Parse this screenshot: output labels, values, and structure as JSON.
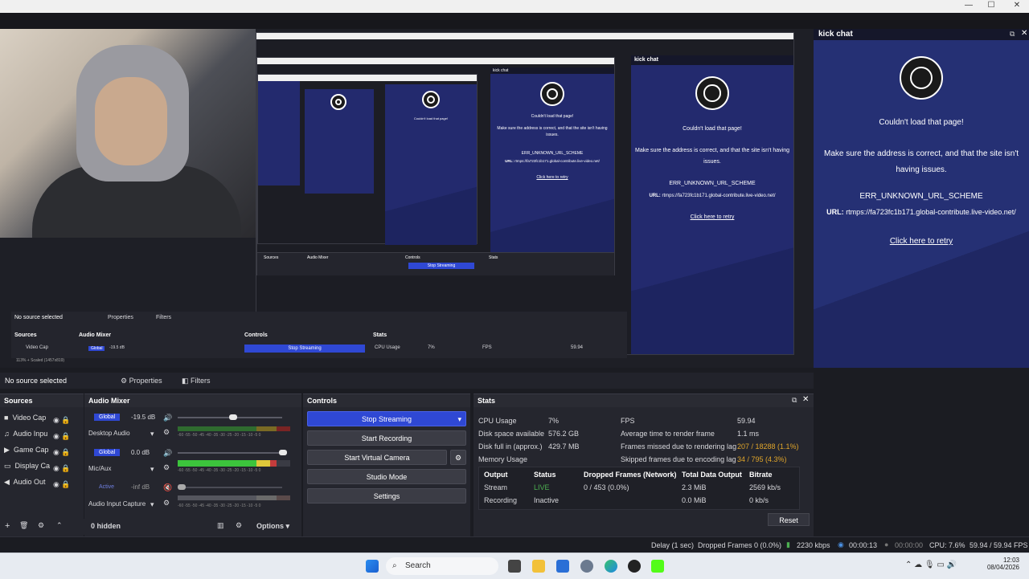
{
  "window": {
    "minimize": "—",
    "maximize": "☐",
    "close": "✕"
  },
  "preview": {
    "nested_chat_title": "kick chat",
    "nested_error_title": "Couldn't load that page!",
    "nested_error_body": "Make sure the address is correct, and that the site isn't having issues.",
    "nested_error_code": "ERR_UNKNOWN_URL_SCHEME",
    "nested_url_label": "URL:",
    "nested_url": "rtmps://fa723fc1b171.global-contribute.live-video.net/",
    "nested_retry": "Click here to retry",
    "nested_no_source": "No source selected",
    "nested_properties": "Properties",
    "nested_filters": "Filters",
    "nested_sources": "Sources",
    "nested_audio_mixer": "Audio Mixer",
    "nested_controls": "Controls",
    "nested_stats": "Stats",
    "nested_video_cap": "Video Cap",
    "nested_stop_streaming": "Stop Streaming",
    "nested_cpu_usage": "CPU Usage",
    "nested_cpu_value": "7%",
    "nested_fps": "FPS",
    "nested_fps_value": "59.94",
    "nested_global": "Global",
    "nested_db": "-19.5 dB",
    "nested_scaled": "113%   +   Scaled (1457x819)"
  },
  "kick_chat": {
    "title": "kick chat",
    "error_title": "Couldn't load that page!",
    "error_body": "Make sure the address is correct, and that the site isn't having issues.",
    "error_code": "ERR_UNKNOWN_URL_SCHEME",
    "url_label": "URL:",
    "url": "rtmps://fa723fc1b171.global-contribute.live-video.net/",
    "retry": "Click here to retry"
  },
  "status_row": {
    "no_source": "No source selected",
    "properties": "Properties",
    "filters": "Filters"
  },
  "sources": {
    "title": "Sources",
    "items": [
      "Video Cap",
      "Audio Inpu",
      "Game Cap",
      "Display Ca",
      "Audio Out"
    ]
  },
  "audio_mixer": {
    "title": "Audio Mixer",
    "channels": [
      {
        "badge": "Global",
        "db": "-19.5 dB",
        "name": "Desktop Audio",
        "level": 0.62
      },
      {
        "badge": "Global",
        "db": "0.0 dB",
        "name": "Mic/Aux",
        "level": 1.0
      },
      {
        "badge": "Active",
        "db": "-inf dB",
        "name": "Audio Input Capture",
        "level": 0.0
      }
    ],
    "ticks": "-60 -55 -50 -45 -40 -35 -30 -25 -20 -15 -10 -5 0"
  },
  "controls": {
    "title": "Controls",
    "stop_streaming": "Stop Streaming",
    "start_recording": "Start Recording",
    "start_virtual_camera": "Start Virtual Camera",
    "studio_mode": "Studio Mode",
    "settings": "Settings"
  },
  "stats": {
    "title": "Stats",
    "cpu_usage_label": "CPU Usage",
    "cpu_usage": "7%",
    "disk_label": "Disk space available",
    "disk": "576.2 GB",
    "disk_full_label": "Disk full in (approx.)",
    "disk_full": "",
    "memory_label": "Memory Usage",
    "memory": "429.7 MB",
    "fps_label": "FPS",
    "fps": "59.94",
    "render_time_label": "Average time to render frame",
    "render_time": "1.1 ms",
    "missed_label": "Frames missed due to rendering lag",
    "missed": "207 / 18288 (1.1%)",
    "skipped_label": "Skipped frames due to encoding lag",
    "skipped": "34 / 795 (4.3%)",
    "table_headers": [
      "Output",
      "Status",
      "Dropped Frames (Network)",
      "Total Data Output",
      "Bitrate"
    ],
    "rows": [
      [
        "Stream",
        "LIVE",
        "0 / 453 (0.0%)",
        "2.3 MiB",
        "2569 kb/s"
      ],
      [
        "Recording",
        "Inactive",
        "",
        "0.0 MiB",
        "0 kb/s"
      ]
    ],
    "reset": "Reset"
  },
  "dock_footer": {
    "hidden": "0 hidden",
    "options": "Options"
  },
  "bottom_status": {
    "delay": "Delay (1 sec)",
    "dropped": "Dropped Frames 0 (0.0%)",
    "bitrate": "2230 kbps",
    "stream_time": "00:00:13",
    "rec_time": "00:00:00",
    "cpu": "CPU: 7.6%",
    "fps": "59.94 / 59.94 FPS"
  },
  "taskbar": {
    "search": "Search",
    "time": "12:03",
    "date": "08/04/2026"
  },
  "colors": {
    "accent": "#2f48d4",
    "kick_bg": "#253074",
    "live": "#4caf50",
    "warning": "#e0a52a"
  }
}
